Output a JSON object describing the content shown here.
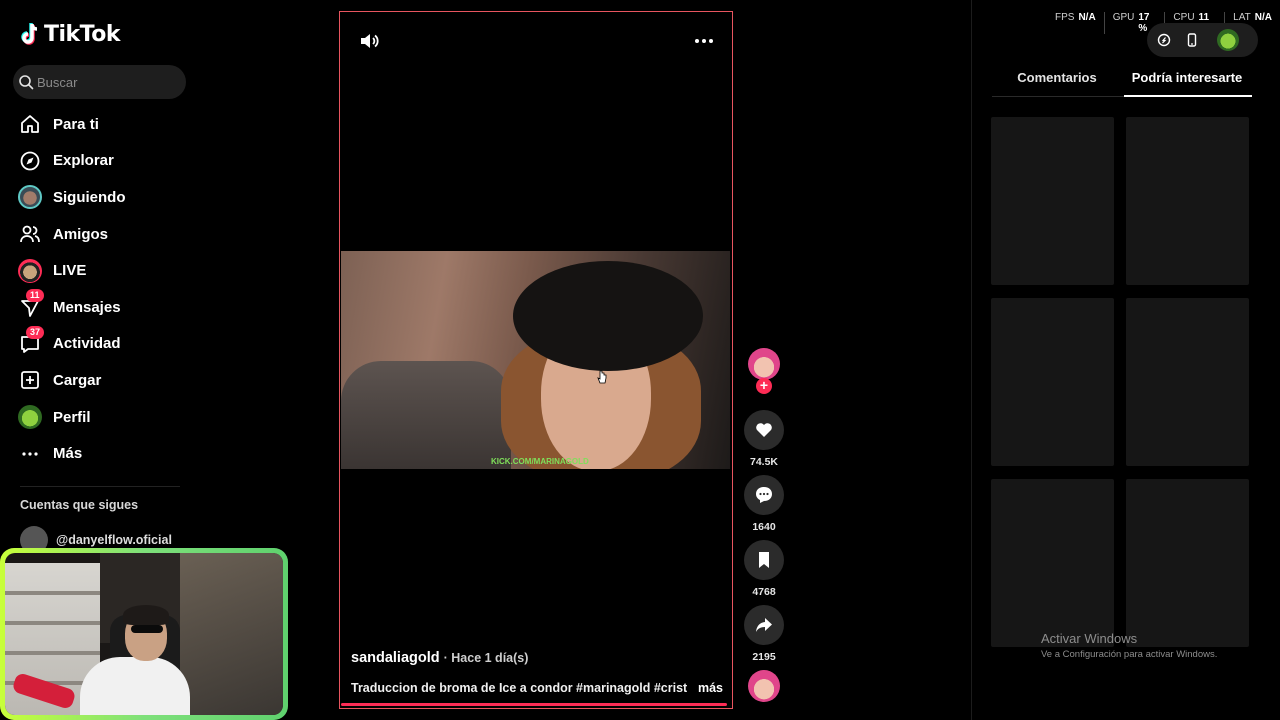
{
  "app": {
    "name": "TikTok"
  },
  "search": {
    "placeholder": "Buscar"
  },
  "nav": {
    "items": [
      {
        "label": "Para ti",
        "icon": "home-icon"
      },
      {
        "label": "Explorar",
        "icon": "compass-icon"
      },
      {
        "label": "Siguiendo",
        "icon": "following-avatar-icon"
      },
      {
        "label": "Amigos",
        "icon": "friends-icon"
      },
      {
        "label": "LIVE",
        "icon": "live-icon"
      },
      {
        "label": "Mensajes",
        "icon": "messages-icon",
        "badge": "11"
      },
      {
        "label": "Actividad",
        "icon": "activity-icon",
        "badge": "37"
      },
      {
        "label": "Cargar",
        "icon": "upload-icon"
      },
      {
        "label": "Perfil",
        "icon": "profile-avatar-icon"
      },
      {
        "label": "Más",
        "icon": "more-dots-icon"
      }
    ]
  },
  "following": {
    "title": "Cuentas que sigues",
    "accounts": [
      {
        "name": "@danyelflow.oficial"
      }
    ]
  },
  "video": {
    "author": "sandaliagold",
    "time": "· Hace 1 día(s)",
    "caption": "Traduccion de broma de Ice a condor #marinagold #cristian...",
    "more": "más",
    "overlay_tag": "KICK.COM/MARINAGOLD"
  },
  "actions": {
    "likes": "74.5K",
    "comments": "1640",
    "saves": "4768",
    "shares": "2195"
  },
  "stats": [
    {
      "label": "FPS",
      "value": "N/A"
    },
    {
      "label": "GPU",
      "value": "17 %"
    },
    {
      "label": "CPU",
      "value": "11 %"
    },
    {
      "label": "LAT",
      "value": "N/A"
    }
  ],
  "panel": {
    "tabs": [
      {
        "label": "Comentarios"
      },
      {
        "label": "Podría interesarte",
        "active": true
      }
    ]
  },
  "watermark": {
    "title": "Activar Windows",
    "subtitle": "Ve a Configuración para activar Windows."
  },
  "colors": {
    "accent": "#fe2c55",
    "frame": "#e8555f",
    "webcam_border": "#c8ff3a"
  }
}
